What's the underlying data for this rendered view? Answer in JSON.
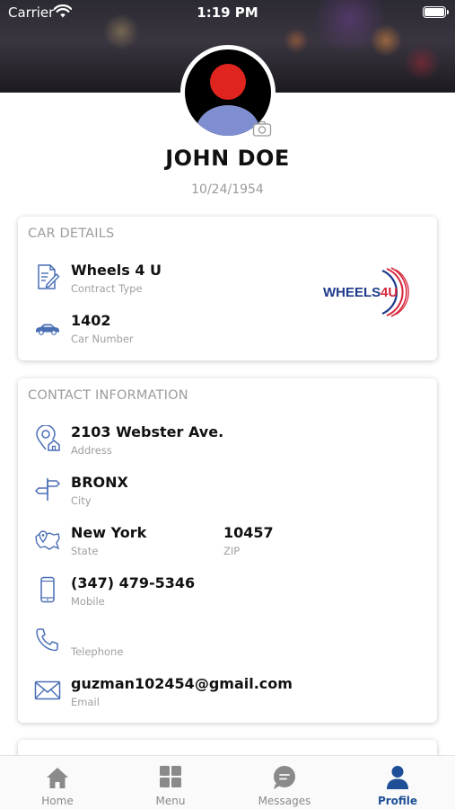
{
  "status_bar": {
    "carrier": "Carrier",
    "time": "1:19 PM"
  },
  "profile": {
    "name": "JOHN DOE",
    "dob": "10/24/1954"
  },
  "car_details": {
    "title": "CAR DETAILS",
    "contract_value": "Wheels 4 U",
    "contract_label": "Contract Type",
    "car_number_value": "1402",
    "car_number_label": "Car Number",
    "logo_text": "WHEELS4U"
  },
  "contact": {
    "title": "CONTACT INFORMATION",
    "address_value": "2103 Webster Ave.",
    "address_label": "Address",
    "city_value": "BRONX",
    "city_label": "City",
    "state_value": "New York",
    "state_label": "State",
    "zip_value": "10457",
    "zip_label": "ZIP",
    "mobile_value": "(347) 479-5346",
    "mobile_label": "Mobile",
    "telephone_value": "",
    "telephone_label": "Telephone",
    "email_value": "guzman102454@gmail.com",
    "email_label": "Email"
  },
  "tabs": [
    {
      "label": "Home",
      "icon": "home-icon"
    },
    {
      "label": "Menu",
      "icon": "grid-icon"
    },
    {
      "label": "Messages",
      "icon": "chat-icon"
    },
    {
      "label": "Profile",
      "icon": "user-icon",
      "active": true
    }
  ],
  "colors": {
    "accent": "#1e4f96",
    "icon_blue": "#4a6fb5",
    "tab_gray": "#8a8a8a"
  }
}
